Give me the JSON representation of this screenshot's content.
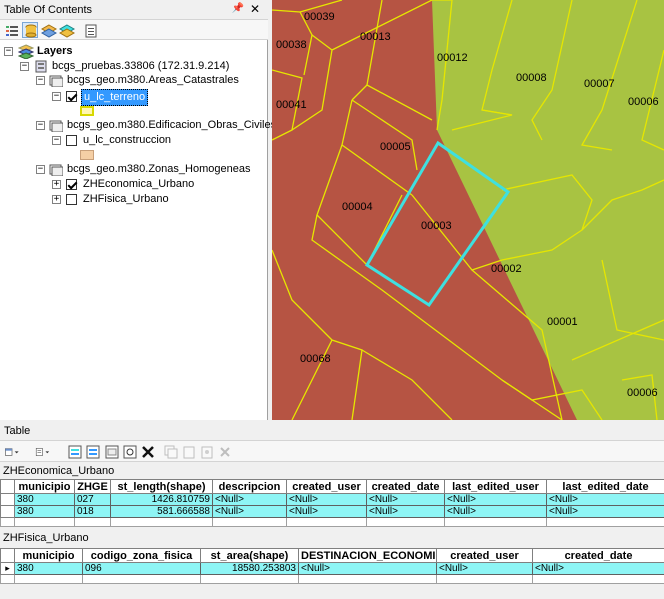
{
  "toc": {
    "title": "Table Of Contents",
    "pin": "ᵒ",
    "close": "✕",
    "layers_label": "Layers",
    "db_label": "bcgs_pruebas.33806 (172.31.9.214)",
    "group1": "bcgs_geo.m380.Areas_Catastrales",
    "layer1": "u_lc_terreno",
    "group2": "bcgs_geo.m380.Edificacion_Obras_Civiles",
    "layer2": "u_lc_construccion",
    "group3": "bcgs_geo.m380.Zonas_Homogeneas",
    "layer3": "ZHEconomica_Urbano",
    "layer4": "ZHFisica_Urbano"
  },
  "map": {
    "labels": [
      "00039",
      "00038",
      "00013",
      "00012",
      "00008",
      "00007",
      "00006",
      "00041",
      "00005",
      "00004",
      "00003",
      "00002",
      "00001",
      "00068",
      "00006"
    ],
    "colors": {
      "parcel_red": "#b65443",
      "parcel_green": "#a8c342",
      "outline": "#e6e600",
      "selection": "#3ee0e0"
    }
  },
  "table": {
    "title": "Table",
    "t1": {
      "name": "ZHEconomica_Urbano",
      "columns": [
        "municipio",
        "ZHGE",
        "st_length(shape)",
        "descripcion",
        "created_user",
        "created_date",
        "last_edited_user",
        "last_edited_date"
      ],
      "rows": [
        [
          "380",
          "027",
          "1426.810759",
          "<Null>",
          "<Null>",
          "<Null>",
          "<Null>",
          "<Null>"
        ],
        [
          "380",
          "018",
          "581.666588",
          "<Null>",
          "<Null>",
          "<Null>",
          "<Null>",
          "<Null>"
        ]
      ]
    },
    "t2": {
      "name": "ZHFisica_Urbano",
      "columns": [
        "municipio",
        "codigo_zona_fisica",
        "st_area(shape)",
        "DESTINACION_ECONOMICA",
        "created_user",
        "created_date"
      ],
      "rows": [
        [
          "380",
          "096",
          "18580.253803",
          "<Null>",
          "<Null>",
          "<Null>"
        ]
      ],
      "row_marker": "▸"
    }
  }
}
